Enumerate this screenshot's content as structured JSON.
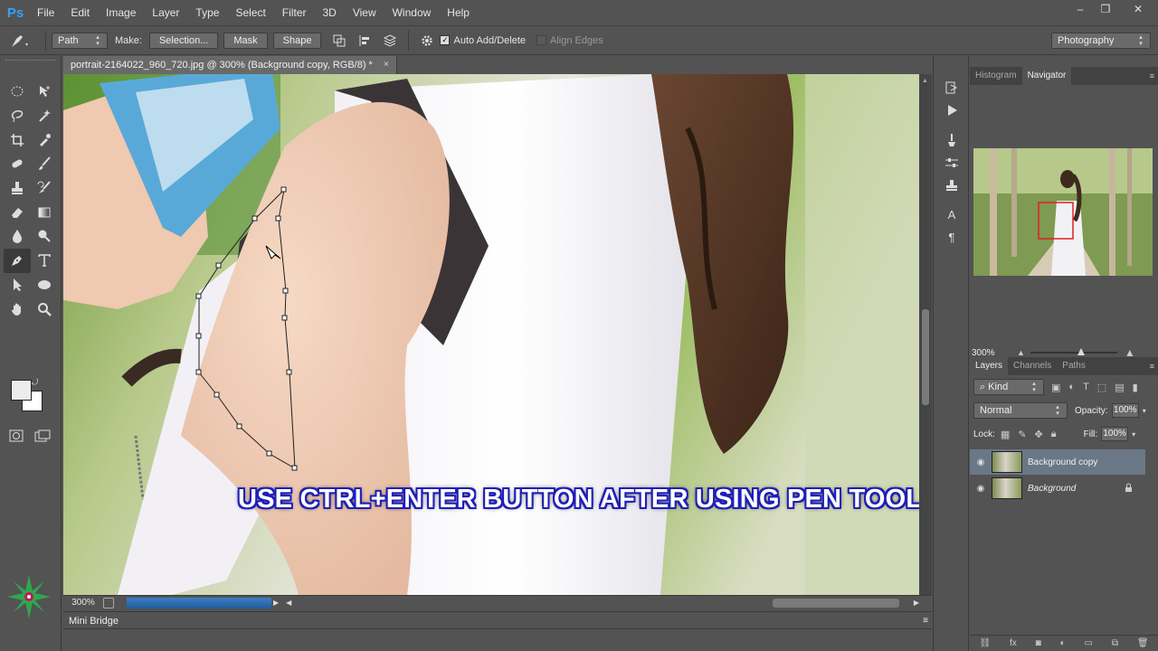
{
  "app": {
    "logo": "Ps"
  },
  "menu": [
    "File",
    "Edit",
    "Image",
    "Layer",
    "Type",
    "Select",
    "Filter",
    "3D",
    "View",
    "Window",
    "Help"
  ],
  "window_controls": [
    "–",
    "❐",
    "✕"
  ],
  "options": {
    "mode": "Path",
    "make_label": "Make:",
    "selection_btn": "Selection...",
    "mask_btn": "Mask",
    "shape_btn": "Shape",
    "auto_add_delete": "Auto Add/Delete",
    "auto_add_delete_checked": true,
    "align_edges": "Align Edges",
    "align_edges_checked": false,
    "workspace": "Photography"
  },
  "document": {
    "tab_title": "portrait-2164022_960_720.jpg @ 300% (Background copy, RGB/8) *",
    "close": "×",
    "zoom": "300%",
    "caption": "USE CTRL+ENTER BUTTON  AFTER USING PEN TOOL"
  },
  "mini_bridge": {
    "label": "Mini Bridge"
  },
  "navigator": {
    "tabs": [
      "Histogram",
      "Navigator"
    ],
    "active_tab": "Navigator",
    "zoom": "300%"
  },
  "layers": {
    "tabs": [
      "Layers",
      "Channels",
      "Paths"
    ],
    "active_tab": "Layers",
    "filter_kind": "Kind",
    "blend_mode": "Normal",
    "opacity_label": "Opacity:",
    "opacity": "100%",
    "lock_label": "Lock:",
    "fill_label": "Fill:",
    "fill": "100%",
    "items": [
      {
        "name": "Background copy",
        "selected": true,
        "locked": false,
        "italic": false
      },
      {
        "name": "Background",
        "selected": false,
        "locked": true,
        "italic": true
      }
    ],
    "footer_icons": [
      "link-icon",
      "fx-icon",
      "mask-icon",
      "adjustment-icon",
      "folder-icon",
      "new-layer-icon",
      "trash-icon"
    ]
  },
  "colors": {
    "chrome": "#535353",
    "panel_dark": "#424242",
    "selection_blue": "#6a7787",
    "caption_stroke": "#1e1fb8"
  }
}
